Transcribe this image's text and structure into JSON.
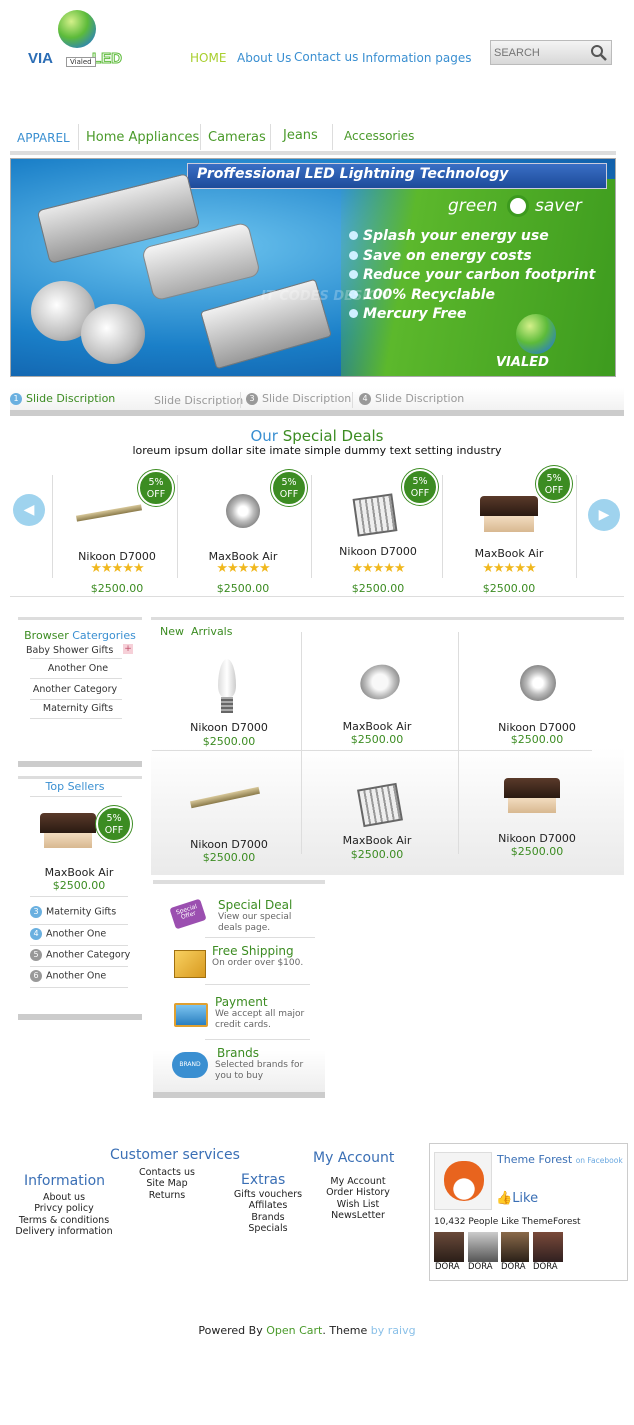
{
  "header": {
    "logo_text_left": "VIA",
    "logo_text_right": "LED",
    "logo_tag": "Vialed",
    "nav": [
      "HOME",
      "About Us",
      "Contact us",
      "Information pages"
    ],
    "search_placeholder": "SEARCH"
  },
  "categories": [
    "APPAREL",
    "Home Appliances",
    "Cameras",
    "Jeans",
    "Accessories"
  ],
  "banner": {
    "title": "Proffessional LED Lightning Technology",
    "brand_left": "green",
    "brand_right": "saver",
    "bullets": [
      "Splash your energy use",
      "Save on energy costs",
      "Reduce your carbon footprint",
      "100% Recyclable",
      "Mercury Free"
    ],
    "watermark": "IT CODES DESIGN",
    "logo": "VIALED"
  },
  "slides": [
    {
      "num": "1",
      "label": "Slide Discription"
    },
    {
      "num": "",
      "label": "Slide Discription"
    },
    {
      "num": "3",
      "label": "Slide Discription"
    },
    {
      "num": "4",
      "label": "Slide Discription"
    }
  ],
  "deals": {
    "title_our": "Our",
    "title_rest": "Special Deals",
    "subtitle": "loreum ipsum dollar site imate simple dummy text setting industry",
    "items": [
      {
        "name": "Nikoon D7000",
        "price": "$2500.00",
        "badge_pct": "5%",
        "badge_off": "OFF",
        "rating": 5
      },
      {
        "name": "MaxBook Air",
        "price": "$2500.00",
        "badge_pct": "5%",
        "badge_off": "OFF",
        "rating": 5
      },
      {
        "name": "Nikoon D7000",
        "price": "$2500.00",
        "badge_pct": "5%",
        "badge_off": "OFF",
        "rating": 5
      },
      {
        "name": "MaxBook Air",
        "price": "$2500.00",
        "badge_pct": "5%",
        "badge_off": "OFF",
        "rating": 5
      }
    ]
  },
  "browse": {
    "title_a": "Browser",
    "title_b": "Catergories",
    "items": [
      "Baby Shower Gifts",
      "Another One",
      "Another Category",
      "Maternity Gifts"
    ],
    "expand_symbol": "+"
  },
  "top_sellers": {
    "title": "Top Sellers",
    "product": {
      "name": "MaxBook Air",
      "price": "$2500.00",
      "badge_pct": "5%",
      "badge_off": "OFF"
    },
    "list": [
      {
        "num": "3",
        "label": "Maternity Gifts"
      },
      {
        "num": "4",
        "label": "Another One"
      },
      {
        "num": "5",
        "label": "Another Category"
      },
      {
        "num": "6",
        "label": "Another One"
      }
    ]
  },
  "arrivals": {
    "title_a": "New",
    "title_b": "Arrivals",
    "items": [
      {
        "name": "Nikoon D7000",
        "price": "$2500.00"
      },
      {
        "name": "MaxBook Air",
        "price": "$2500.00"
      },
      {
        "name": "Nikoon D7000",
        "price": "$2500.00"
      },
      {
        "name": "Nikoon D7000",
        "price": "$2500.00"
      },
      {
        "name": "MaxBook Air",
        "price": "$2500.00"
      },
      {
        "name": "Nikoon D7000",
        "price": "$2500.00"
      }
    ]
  },
  "features": [
    {
      "title": "Special Deal",
      "desc": "View our special deals page.",
      "tag": "Special Offer"
    },
    {
      "title": "Free Shipping",
      "desc": "On order over $100."
    },
    {
      "title": "Payment",
      "desc": "We accept all major  credit cards."
    },
    {
      "title": "Brands",
      "desc": "Selected brands for you to buy",
      "tag": "BRAND"
    }
  ],
  "footer": {
    "information": {
      "title": "Information",
      "links": [
        "About us",
        "Privcy policy",
        "Terms & conditions",
        "Delivery information"
      ]
    },
    "customer": {
      "title": "Customer services",
      "links": [
        "Contacts us",
        "Site Map",
        "Returns"
      ]
    },
    "extras": {
      "title": "Extras",
      "links": [
        "Gifts vouchers",
        "Affilates",
        "Brands",
        "Specials"
      ]
    },
    "account": {
      "title": "My Account",
      "links": [
        "My Account",
        "Order History",
        "Wish List",
        "NewsLetter"
      ]
    },
    "facebook": {
      "page": "Theme Forest",
      "on": "on Facebook",
      "like": "Like",
      "count": "10,432 People Like ThemeForest",
      "fans": [
        "DORA",
        "DORA",
        "DORA",
        "DORA"
      ]
    },
    "powered_prefix": "Powered By",
    "powered_link": "Open Cart",
    "theme_prefix": ". Theme",
    "theme_by": "by raivg"
  },
  "colors": {
    "accent_green": "#3c8c22",
    "accent_blue": "#3a8fd1"
  }
}
